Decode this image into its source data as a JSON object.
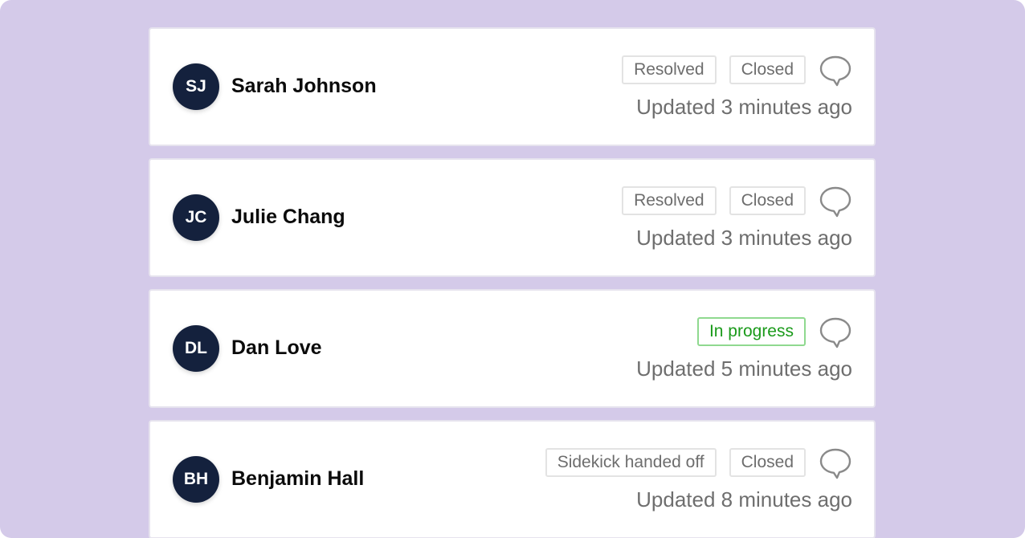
{
  "tickets": [
    {
      "initials": "SJ",
      "name": "Sarah Johnson",
      "badges": [
        {
          "label": "Resolved",
          "variant": "neutral"
        },
        {
          "label": "Closed",
          "variant": "neutral"
        }
      ],
      "updated": "Updated 3 minutes ago"
    },
    {
      "initials": "JC",
      "name": "Julie Chang",
      "badges": [
        {
          "label": "Resolved",
          "variant": "neutral"
        },
        {
          "label": "Closed",
          "variant": "neutral"
        }
      ],
      "updated": "Updated 3 minutes ago"
    },
    {
      "initials": "DL",
      "name": "Dan Love",
      "badges": [
        {
          "label": "In progress",
          "variant": "green"
        }
      ],
      "updated": "Updated 5 minutes ago"
    },
    {
      "initials": "BH",
      "name": "Benjamin Hall",
      "badges": [
        {
          "label": "Sidekick handed off",
          "variant": "neutral"
        },
        {
          "label": "Closed",
          "variant": "neutral"
        }
      ],
      "updated": "Updated 8 minutes ago"
    }
  ],
  "icons": {
    "comment": "comment-icon"
  },
  "colors": {
    "background": "#d4cae9",
    "avatar": "#14213d",
    "green": "#1a9a1a"
  }
}
